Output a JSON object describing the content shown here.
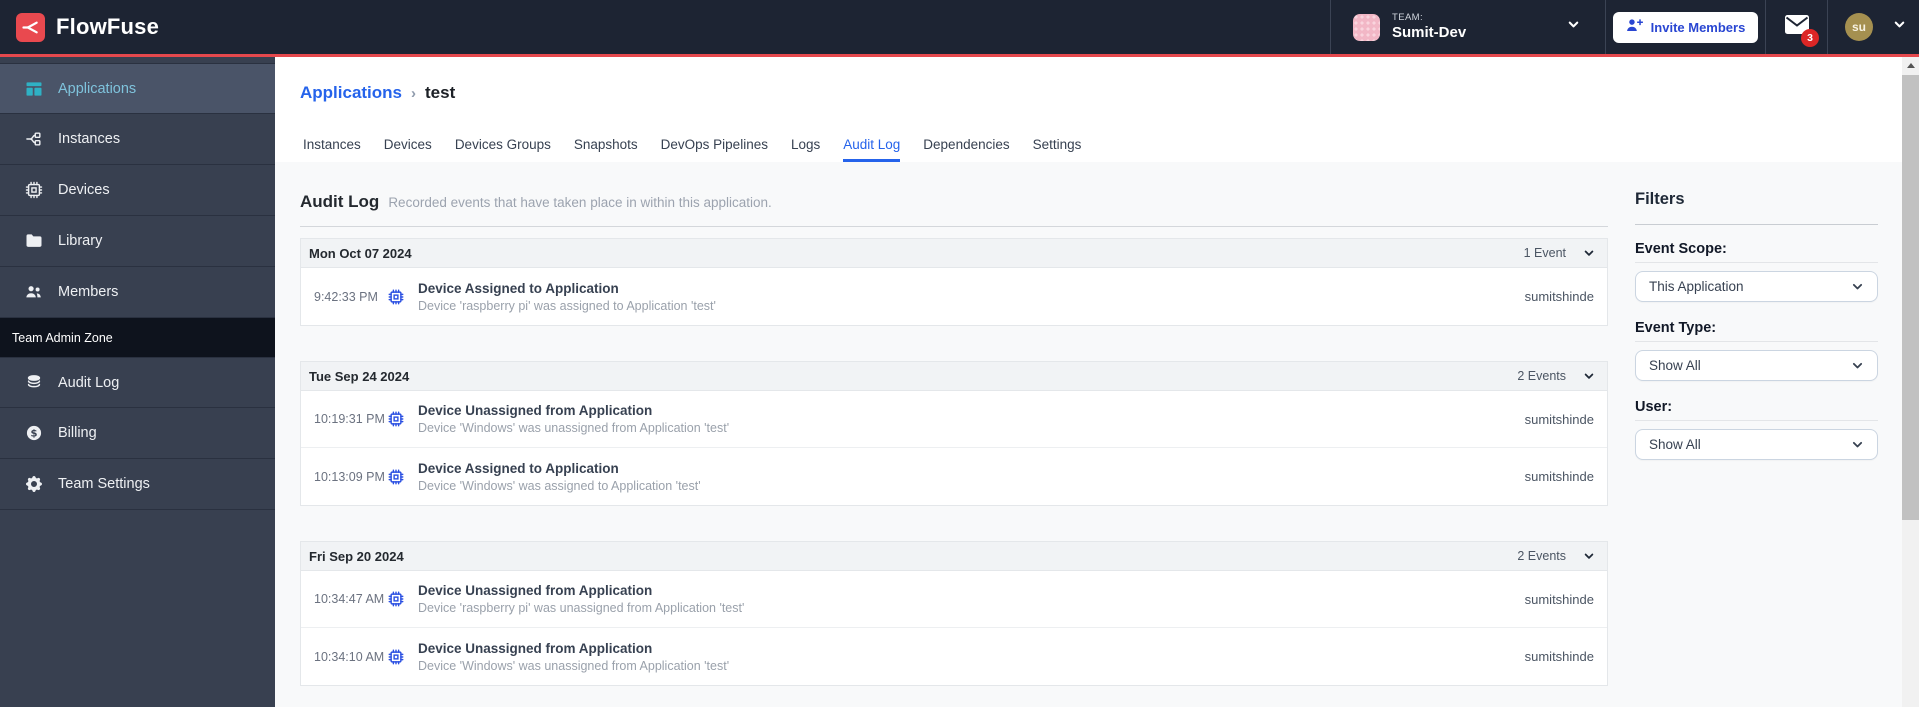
{
  "topbar": {
    "brand": "FlowFuse",
    "team_label": "TEAM:",
    "team_name": "Sumit-Dev",
    "invite_button": "Invite Members",
    "notification_count": "3",
    "avatar_initials": "su"
  },
  "sidebar": {
    "items": [
      {
        "label": "Applications",
        "icon": "applications-template-icon",
        "active": true
      },
      {
        "label": "Instances",
        "icon": "instances-branch-icon",
        "active": false
      },
      {
        "label": "Devices",
        "icon": "cpu-chip-icon",
        "active": false
      },
      {
        "label": "Library",
        "icon": "folder-icon",
        "active": false
      },
      {
        "label": "Members",
        "icon": "users-icon",
        "active": false
      }
    ],
    "admin_zone_label": "Team Admin Zone",
    "admin_items": [
      {
        "label": "Audit Log",
        "icon": "database-icon"
      },
      {
        "label": "Billing",
        "icon": "dollar-circle-icon"
      },
      {
        "label": "Team Settings",
        "icon": "gear-icon"
      }
    ]
  },
  "breadcrumb": {
    "parent": "Applications",
    "separator": "›",
    "current": "test"
  },
  "tabs": [
    {
      "label": "Instances"
    },
    {
      "label": "Devices"
    },
    {
      "label": "Devices Groups"
    },
    {
      "label": "Snapshots"
    },
    {
      "label": "DevOps Pipelines"
    },
    {
      "label": "Logs"
    },
    {
      "label": "Audit Log",
      "active": true
    },
    {
      "label": "Dependencies"
    },
    {
      "label": "Settings"
    }
  ],
  "main": {
    "title": "Audit Log",
    "subtitle": "Recorded events that have taken place in within this application."
  },
  "groups": [
    {
      "date": "Mon Oct 07 2024",
      "count_label": "1 Event",
      "events": [
        {
          "time": "9:42:33 PM",
          "title": "Device Assigned to Application",
          "description": "Device 'raspberry pi' was assigned to Application 'test'",
          "user": "sumitshinde"
        }
      ]
    },
    {
      "date": "Tue Sep 24 2024",
      "count_label": "2 Events",
      "events": [
        {
          "time": "10:19:31 PM",
          "title": "Device Unassigned from Application",
          "description": "Device 'Windows' was unassigned from Application 'test'",
          "user": "sumitshinde"
        },
        {
          "time": "10:13:09 PM",
          "title": "Device Assigned to Application",
          "description": "Device 'Windows' was assigned to Application 'test'",
          "user": "sumitshinde"
        }
      ]
    },
    {
      "date": "Fri Sep 20 2024",
      "count_label": "2 Events",
      "events": [
        {
          "time": "10:34:47 AM",
          "title": "Device Unassigned from Application",
          "description": "Device 'raspberry pi' was unassigned from Application 'test'",
          "user": "sumitshinde"
        },
        {
          "time": "10:34:10 AM",
          "title": "Device Unassigned from Application",
          "description": "Device 'Windows' was unassigned from Application 'test'",
          "user": "sumitshinde"
        }
      ]
    }
  ],
  "filters": {
    "title": "Filters",
    "fields": [
      {
        "label": "Event Scope:",
        "value": "This Application"
      },
      {
        "label": "Event Type:",
        "value": "Show All"
      },
      {
        "label": "User:",
        "value": "Show All"
      }
    ]
  },
  "colors": {
    "navbar_bg": "#1d2433",
    "sidebar_bg": "#384050",
    "brand_red": "#e5484d",
    "accent_blue": "#2563eb",
    "active_teal": "#2fb1c4",
    "badge_red": "#dc2626",
    "content_bg": "#f8f9fa"
  }
}
